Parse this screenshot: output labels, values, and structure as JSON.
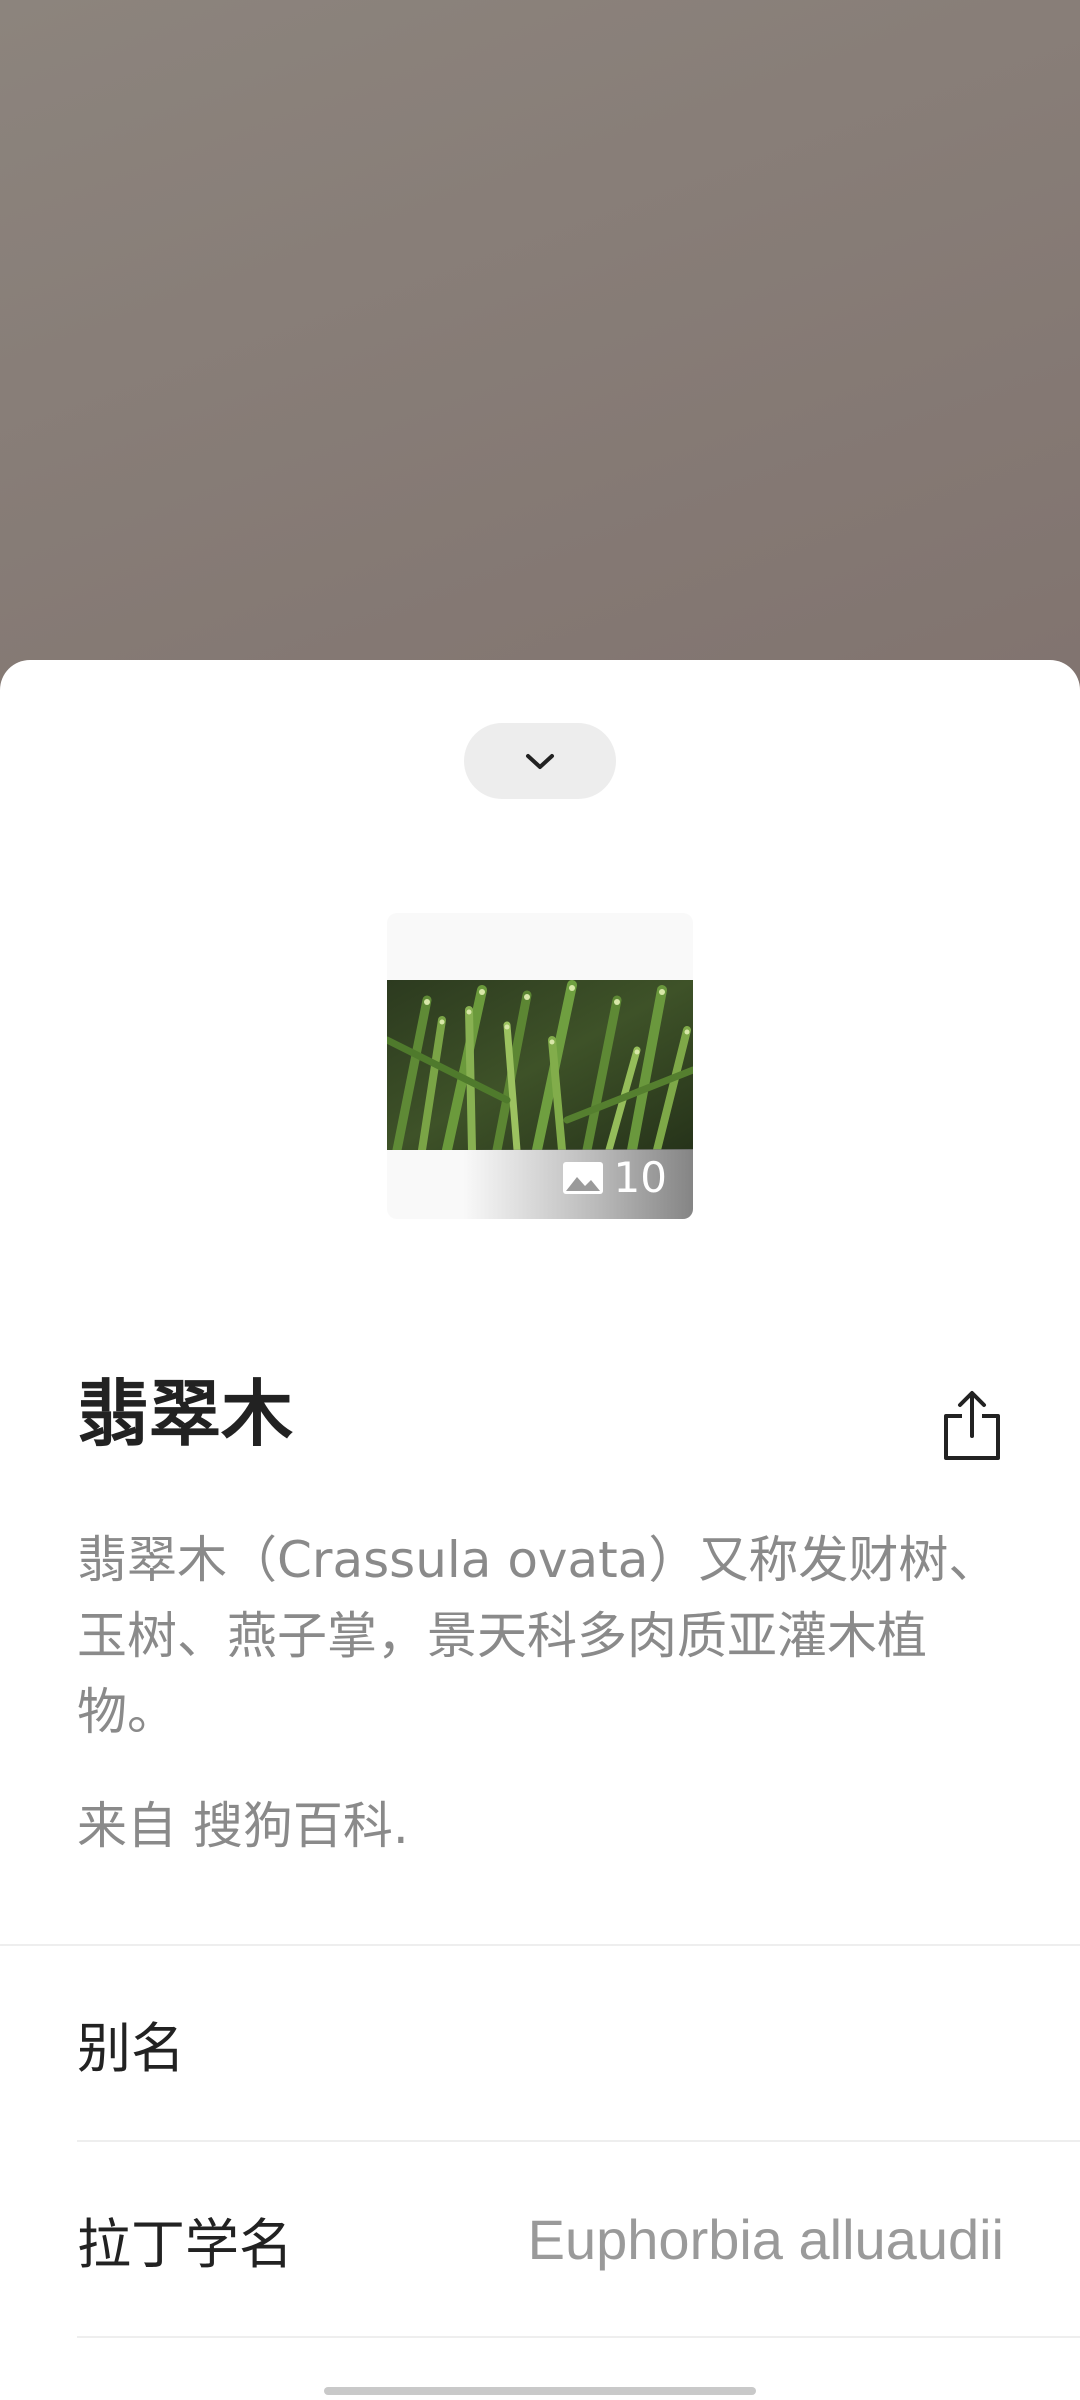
{
  "sheet": {
    "collapse_icon": "chevron-down-icon",
    "gallery": {
      "image_count": "10",
      "icon": "image-icon"
    },
    "title": "翡翠木",
    "share_icon": "share-icon",
    "description": "翡翠木（Crassula ovata）又称发财树、玉树、燕子掌，景天科多肉质亚灌木植物。",
    "source_prefix": "来自 ",
    "source_name": "搜狗百科",
    "source_suffix": ".",
    "rows": [
      {
        "label": "别名",
        "value": ""
      },
      {
        "label": "拉丁学名",
        "value": "Euphorbia alluaudii"
      }
    ]
  },
  "colors": {
    "background_top": "#8c847d",
    "background_bottom": "#6f5953",
    "title": "#222222",
    "secondary_text": "#8a8a8a"
  }
}
